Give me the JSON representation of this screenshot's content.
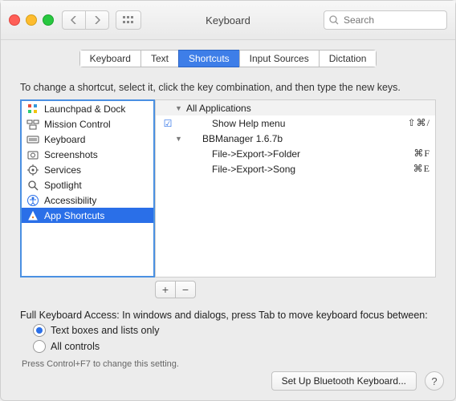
{
  "window": {
    "title": "Keyboard"
  },
  "search": {
    "placeholder": "Search"
  },
  "tabs": [
    "Keyboard",
    "Text",
    "Shortcuts",
    "Input Sources",
    "Dictation"
  ],
  "activeTabIndex": 2,
  "instruction": "To change a shortcut, select it, click the key combination, and then type the new keys.",
  "sidebar": {
    "items": [
      {
        "label": "Launchpad & Dock",
        "icon": "launchpad"
      },
      {
        "label": "Mission Control",
        "icon": "mission-control"
      },
      {
        "label": "Keyboard",
        "icon": "keyboard"
      },
      {
        "label": "Screenshots",
        "icon": "screenshots"
      },
      {
        "label": "Services",
        "icon": "services"
      },
      {
        "label": "Spotlight",
        "icon": "spotlight"
      },
      {
        "label": "Accessibility",
        "icon": "accessibility"
      },
      {
        "label": "App Shortcuts",
        "icon": "app-shortcuts"
      }
    ],
    "selectedIndex": 7
  },
  "shortcuts": {
    "rows": [
      {
        "type": "group",
        "label": "All Applications"
      },
      {
        "type": "item",
        "checked": true,
        "label": "Show Help menu",
        "key": "⇧⌘/"
      },
      {
        "type": "group",
        "label": "BBManager 1.6.7b"
      },
      {
        "type": "item",
        "checked": false,
        "label": "File->Export->Folder",
        "key": "⌘F"
      },
      {
        "type": "item",
        "checked": false,
        "label": "File->Export->Song",
        "key": "⌘E"
      }
    ]
  },
  "keyboardAccess": {
    "label": "Full Keyboard Access: In windows and dialogs, press Tab to move keyboard focus between:",
    "options": [
      "Text boxes and lists only",
      "All controls"
    ],
    "selectedIndex": 0,
    "hint": "Press Control+F7 to change this setting."
  },
  "footer": {
    "bluetooth": "Set Up Bluetooth Keyboard...",
    "help": "?"
  }
}
